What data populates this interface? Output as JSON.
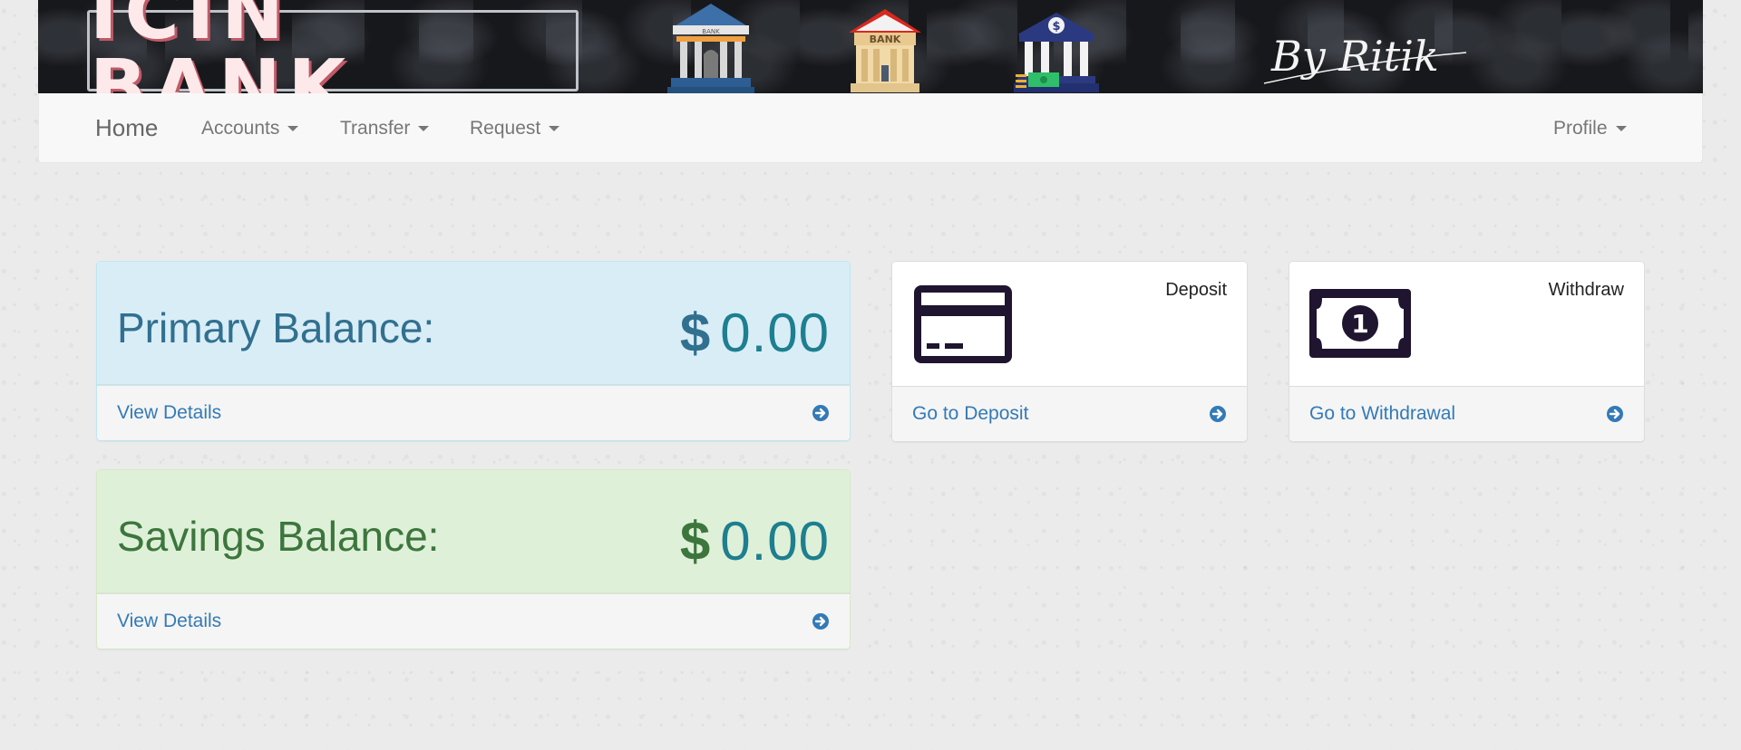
{
  "header": {
    "brand": "ICIN BANK",
    "bank_icon_label": "BANK",
    "bank_icon_small_label": "BANK",
    "coin_symbol": "$",
    "signature": "By Ritik"
  },
  "nav": {
    "home": "Home",
    "accounts": "Accounts",
    "transfer": "Transfer",
    "request": "Request",
    "profile": "Profile"
  },
  "balances": {
    "primary": {
      "label": "Primary Balance:",
      "currency": "$",
      "amount": "0.00",
      "link": "View Details"
    },
    "savings": {
      "label": "Savings Balance:",
      "currency": "$",
      "amount": "0.00",
      "link": "View Details"
    }
  },
  "actions": {
    "deposit": {
      "title": "Deposit",
      "link": "Go to Deposit",
      "icon": "credit-card-icon"
    },
    "withdraw": {
      "title": "Withdraw",
      "link": "Go to Withdrawal",
      "icon": "banknote-icon",
      "note_digit": "1"
    }
  },
  "colors": {
    "link": "#337ab7",
    "info_bg": "#d9edf7",
    "success_bg": "#dff0d8",
    "amount": "#1d7f8f",
    "banner_bg": "#17181b"
  }
}
